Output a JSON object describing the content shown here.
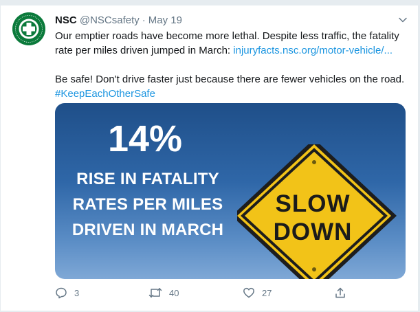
{
  "tweet": {
    "author_name": "NSC",
    "handle": "@NSCsafety",
    "separator": "·",
    "date": "May 19",
    "line1": "Our emptier roads have become more lethal. Despite less traffic, the fatality rate per miles driven jumped in March: ",
    "link": "injuryfacts.nsc.org/motor-vehicle/...",
    "line2": "Be safe! Don't drive faster just because there are fewer vehicles on the road.",
    "hashtag": "#KeepEachOtherSafe"
  },
  "avatar": {
    "logo_text": "NATIONAL SAFETY COUNCIL",
    "color": "#0b7a3b"
  },
  "media": {
    "percent": "14%",
    "headline": "RISE IN FATALITY RATES PER MILES DRIVEN IN MARCH",
    "sign_line1": "SLOW",
    "sign_line2": "DOWN"
  },
  "actions": {
    "reply_count": "3",
    "retweet_count": "40",
    "like_count": "27"
  },
  "colors": {
    "link": "#1b95e0",
    "muted": "#657786",
    "sign_yellow": "#f2c318"
  }
}
